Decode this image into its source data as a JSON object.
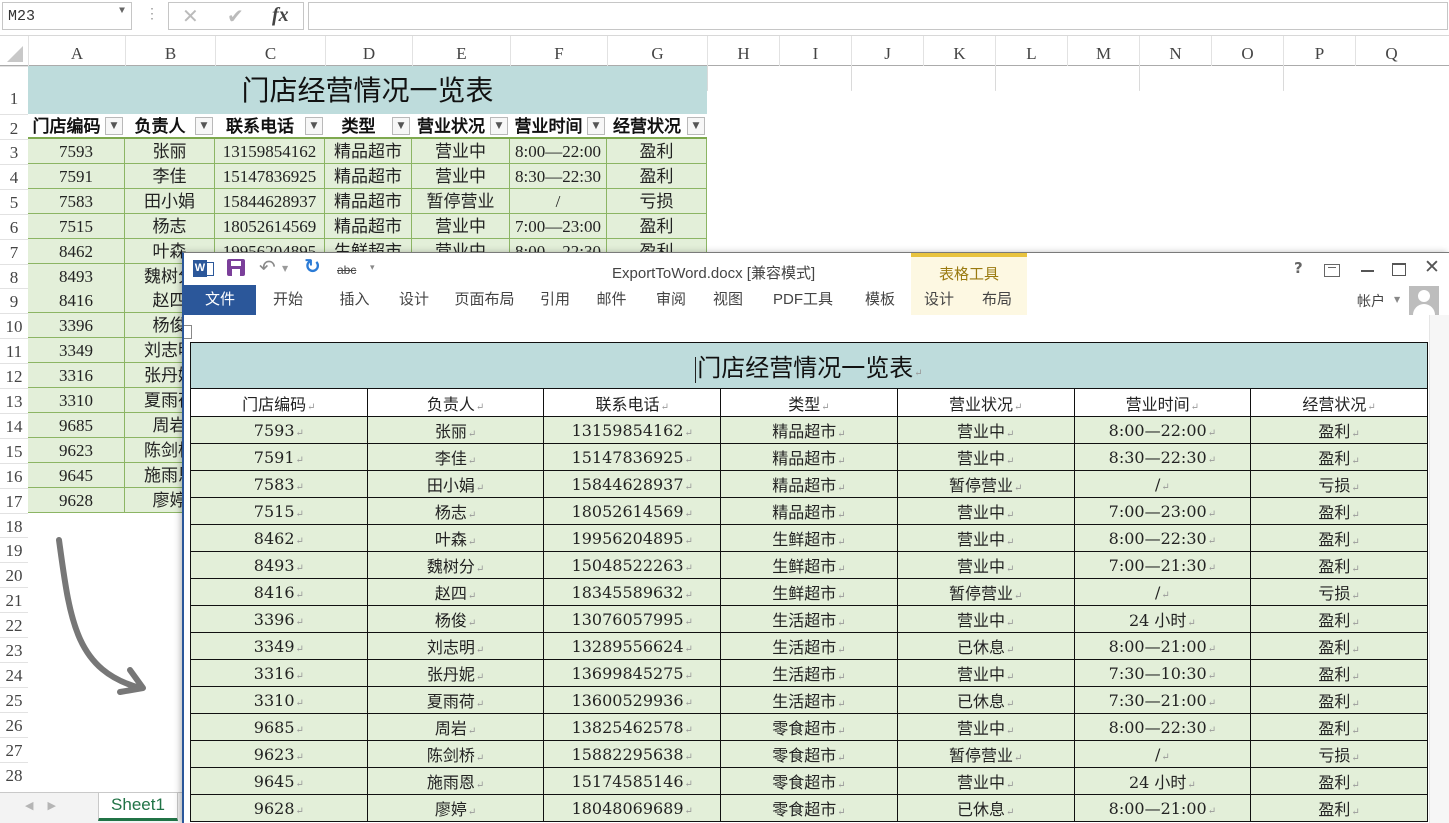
{
  "excel": {
    "name_box": "M23",
    "formula_value": "",
    "fx_label": "fx",
    "columns": [
      "A",
      "B",
      "C",
      "D",
      "E",
      "F",
      "G",
      "H",
      "I",
      "J",
      "K",
      "L",
      "M",
      "N",
      "O",
      "P",
      "Q"
    ],
    "rows": [
      "1",
      "2",
      "3",
      "4",
      "5",
      "6",
      "7",
      "8",
      "9",
      "10",
      "11",
      "12",
      "13",
      "14",
      "15",
      "16",
      "17",
      "18",
      "19",
      "20",
      "21",
      "22",
      "23",
      "24",
      "25",
      "26",
      "27",
      "28"
    ],
    "title": "门店经营情况一览表",
    "headers": [
      "门店编码",
      "负责人",
      "联系电话",
      "类型",
      "营业状况",
      "营业时间",
      "经营状况"
    ],
    "sheet_tab": "Sheet1"
  },
  "word": {
    "doc_title": "ExportToWord.docx [兼容模式]",
    "context_group": "表格工具",
    "tabs": [
      "文件",
      "开始",
      "插入",
      "设计",
      "页面布局",
      "引用",
      "邮件",
      "审阅",
      "视图",
      "PDF工具",
      "模板",
      "设计",
      "布局"
    ],
    "account": "帐户",
    "help": "?",
    "abc": "abc",
    "table_title": "门店经营情况一览表"
  },
  "table": {
    "headers": [
      "门店编码",
      "负责人",
      "联系电话",
      "类型",
      "营业状况",
      "营业时间",
      "经营状况"
    ],
    "rows": [
      [
        "7593",
        "张丽",
        "13159854162",
        "精品超市",
        "营业中",
        "8:00—22:00",
        "盈利"
      ],
      [
        "7591",
        "李佳",
        "15147836925",
        "精品超市",
        "营业中",
        "8:30—22:30",
        "盈利"
      ],
      [
        "7583",
        "田小娟",
        "15844628937",
        "精品超市",
        "暂停营业",
        "/",
        "亏损"
      ],
      [
        "7515",
        "杨志",
        "18052614569",
        "精品超市",
        "营业中",
        "7:00—23:00",
        "盈利"
      ],
      [
        "8462",
        "叶森",
        "19956204895",
        "生鲜超市",
        "营业中",
        "8:00—22:30",
        "盈利"
      ],
      [
        "8493",
        "魏树分",
        "15048522263",
        "生鲜超市",
        "营业中",
        "7:00—21:30",
        "盈利"
      ],
      [
        "8416",
        "赵四",
        "18345589632",
        "生鲜超市",
        "暂停营业",
        "/",
        "亏损"
      ],
      [
        "3396",
        "杨俊",
        "13076057995",
        "生活超市",
        "营业中",
        "24 小时",
        "盈利"
      ],
      [
        "3349",
        "刘志明",
        "13289556624",
        "生活超市",
        "已休息",
        "8:00—21:00",
        "盈利"
      ],
      [
        "3316",
        "张丹妮",
        "13699845275",
        "生活超市",
        "营业中",
        "7:30—10:30",
        "盈利"
      ],
      [
        "3310",
        "夏雨荷",
        "13600529936",
        "生活超市",
        "已休息",
        "7:30—21:00",
        "盈利"
      ],
      [
        "9685",
        "周岩",
        "13825462578",
        "零食超市",
        "营业中",
        "8:00—22:30",
        "盈利"
      ],
      [
        "9623",
        "陈剑桥",
        "15882295638",
        "零食超市",
        "暂停营业",
        "/",
        "亏损"
      ],
      [
        "9645",
        "施雨恩",
        "15174585146",
        "零食超市",
        "营业中",
        "24 小时",
        "盈利"
      ],
      [
        "9628",
        "廖婷",
        "18048069689",
        "零食超市",
        "已休息",
        "8:00—21:00",
        "盈利"
      ]
    ]
  }
}
